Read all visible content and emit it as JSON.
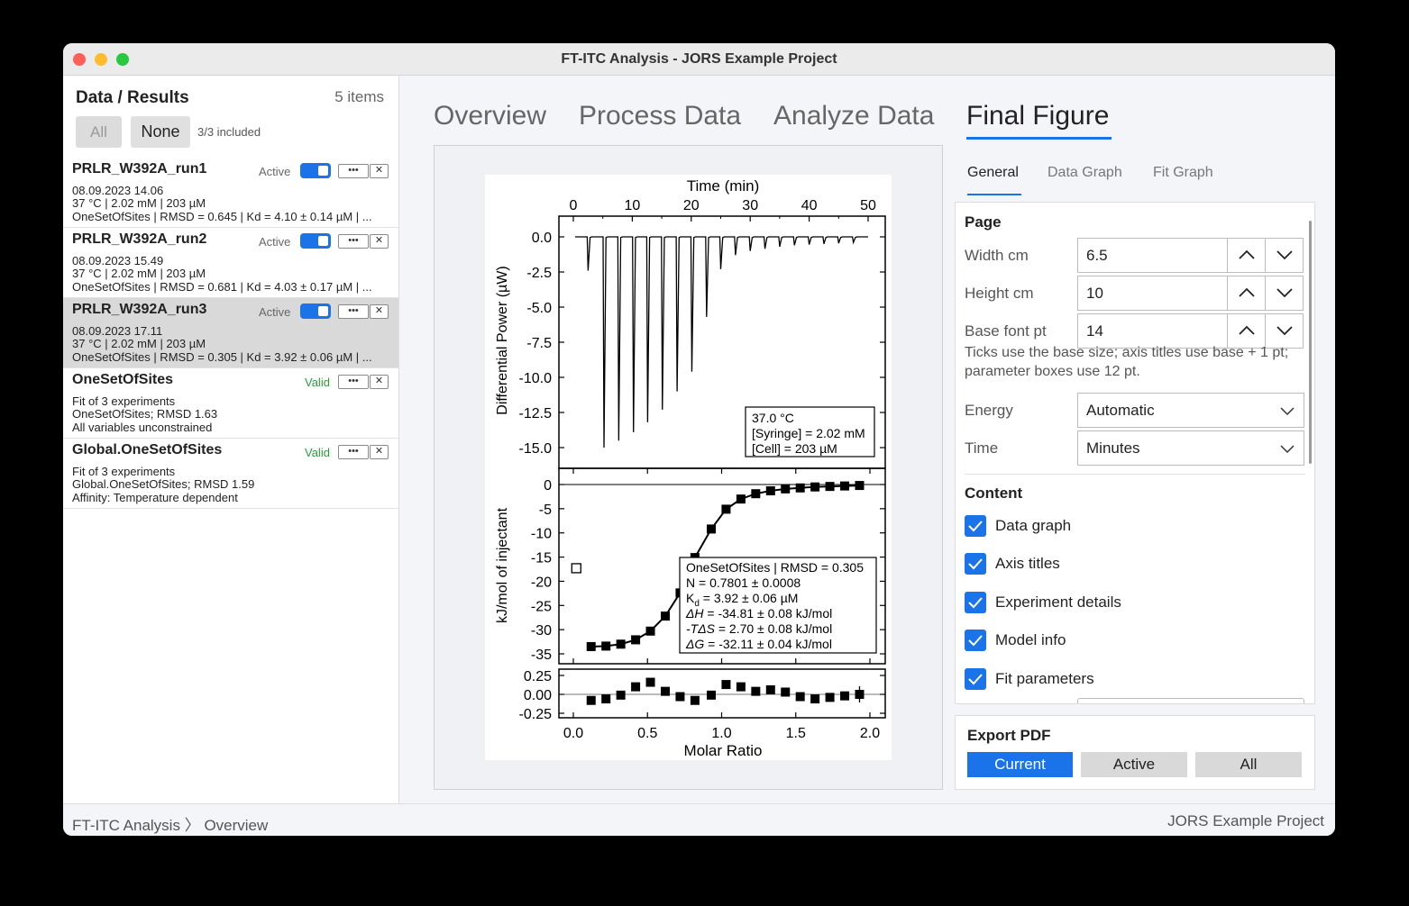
{
  "window": {
    "title": "FT-ITC Analysis - JORS Example Project"
  },
  "sidebar": {
    "title": "Data / Results",
    "count": "5 items",
    "btn_all": "All",
    "btn_none": "None",
    "included": "3/3 included",
    "items": [
      {
        "name": "PRLR_W392A_run1",
        "status": "Active",
        "line1": "08.09.2023 14.06",
        "line2": "37 °C | 2.02 mM | 203 µM",
        "line3": "OneSetOfSites | RMSD = 0.645 | Kd = 4.10 ± 0.14 µM | ..."
      },
      {
        "name": "PRLR_W392A_run2",
        "status": "Active",
        "line1": "08.09.2023 15.49",
        "line2": "37 °C | 2.02 mM | 203 µM",
        "line3": "OneSetOfSites | RMSD = 0.681 | Kd = 4.03 ± 0.17 µM | ..."
      },
      {
        "name": "PRLR_W392A_run3",
        "status": "Active",
        "line1": "08.09.2023 17.11",
        "line2": "37 °C | 2.02 mM | 203 µM",
        "line3": "OneSetOfSites | RMSD = 0.305 | Kd = 3.92 ± 0.06 µM | ..."
      },
      {
        "name": "OneSetOfSites",
        "status": "Valid",
        "line1": "Fit of 3 experiments",
        "line2": "OneSetOfSites; RMSD 1.63",
        "line3": "All variables unconstrained"
      },
      {
        "name": "Global.OneSetOfSites",
        "status": "Valid",
        "line1": "Fit of 3 experiments",
        "line2": "Global.OneSetOfSites; RMSD 1.59",
        "line3": "Affinity: Temperature dependent"
      }
    ]
  },
  "tabs": [
    "Overview",
    "Process Data",
    "Analyze Data",
    "Final Figure"
  ],
  "subtabs": [
    "General",
    "Data Graph",
    "Fit Graph"
  ],
  "figure": {
    "top_xlabel": "Time (min)",
    "top_ylabel": "Differential Power (µW)",
    "bottom_xlabel": "Molar Ratio",
    "mid_ylabel": "kJ/mol of injectant",
    "time_ticks": [
      "0",
      "10",
      "20",
      "30",
      "40",
      "50"
    ],
    "power_ticks": [
      "0.0",
      "-2.5",
      "-5.0",
      "-7.5",
      "-10.0",
      "-12.5",
      "-15.0"
    ],
    "enthalpy_ticks": [
      "0",
      "-5",
      "-10",
      "-15",
      "-20",
      "-25",
      "-30",
      "-35"
    ],
    "residual_ticks": [
      "0.25",
      "0.00",
      "-0.25"
    ],
    "ratio_ticks": [
      "0.0",
      "0.5",
      "1.0",
      "1.5",
      "2.0"
    ],
    "cond_box": [
      "37.0 °C",
      "[Syringe] = 2.02 mM",
      "[Cell] = 203 µM"
    ],
    "fit_box": {
      "line1": "OneSetOfSites | RMSD = 0.305",
      "line2": "N = 0.7801 ± 0.0008",
      "kd_sym": "K",
      "kd_sub": "d",
      "kd_val": " = 3.92 ± 0.06 µM",
      "dh_sym": "ΔH",
      "dh_val": " = -34.81 ± 0.08 kJ/mol",
      "ts_sym": "-TΔS",
      "ts_val": " = 2.70 ± 0.08 kJ/mol",
      "dg_sym": "ΔG",
      "dg_val": " = -32.11 ± 0.04 kJ/mol"
    },
    "injections": [
      {
        "t": 2.5,
        "p": -2.4
      },
      {
        "t": 5.2,
        "p": -15.0
      },
      {
        "t": 7.7,
        "p": -14.5
      },
      {
        "t": 10.2,
        "p": -13.9
      },
      {
        "t": 12.6,
        "p": -13.2
      },
      {
        "t": 15.1,
        "p": -12.3
      },
      {
        "t": 17.6,
        "p": -11.0
      },
      {
        "t": 20.1,
        "p": -9.6
      },
      {
        "t": 22.6,
        "p": -5.7
      },
      {
        "t": 25.0,
        "p": -2.3
      },
      {
        "t": 27.5,
        "p": -1.3
      },
      {
        "t": 30.0,
        "p": -1.0
      },
      {
        "t": 32.5,
        "p": -0.85
      },
      {
        "t": 35.0,
        "p": -0.7
      },
      {
        "t": 37.5,
        "p": -0.6
      },
      {
        "t": 40.0,
        "p": -0.55
      },
      {
        "t": 42.5,
        "p": -0.5
      },
      {
        "t": 45.0,
        "p": -0.45
      },
      {
        "t": 47.5,
        "p": -0.4
      }
    ],
    "isotherm_points": [
      {
        "x": 0.12,
        "y": -33.5,
        "r": -0.08
      },
      {
        "x": 0.22,
        "y": -33.4,
        "r": -0.06
      },
      {
        "x": 0.32,
        "y": -33.0,
        "r": -0.01
      },
      {
        "x": 0.42,
        "y": -32.1,
        "r": 0.1
      },
      {
        "x": 0.52,
        "y": -30.3,
        "r": 0.16
      },
      {
        "x": 0.62,
        "y": -27.2,
        "r": 0.04
      },
      {
        "x": 0.72,
        "y": -22.4,
        "r": -0.03
      },
      {
        "x": 0.82,
        "y": -15.1,
        "r": -0.08
      },
      {
        "x": 0.93,
        "y": -9.2,
        "r": -0.01
      },
      {
        "x": 1.03,
        "y": -5.1,
        "r": 0.13
      },
      {
        "x": 1.13,
        "y": -3.0,
        "r": 0.1
      },
      {
        "x": 1.23,
        "y": -1.9,
        "r": 0.04
      },
      {
        "x": 1.33,
        "y": -1.3,
        "r": 0.06
      },
      {
        "x": 1.43,
        "y": -0.9,
        "r": 0.03
      },
      {
        "x": 1.53,
        "y": -0.7,
        "r": -0.03
      },
      {
        "x": 1.63,
        "y": -0.5,
        "r": -0.06
      },
      {
        "x": 1.73,
        "y": -0.4,
        "r": -0.04
      },
      {
        "x": 1.83,
        "y": -0.3,
        "r": -0.02
      },
      {
        "x": 1.93,
        "y": -0.2,
        "r": 0.0
      }
    ],
    "excluded_point": {
      "x": 0.02,
      "y": -17.3
    }
  },
  "settings": {
    "page_title": "Page",
    "width_label": "Width cm",
    "width_value": "6.5",
    "height_label": "Height cm",
    "height_value": "10",
    "font_label": "Base font pt",
    "font_value": "14",
    "hint": "Ticks use the base size; axis titles use base + 1 pt; parameter boxes use 12 pt.",
    "energy_label": "Energy",
    "energy_value": "Automatic",
    "time_label": "Time",
    "time_value": "Minutes",
    "content_title": "Content",
    "checkboxes": [
      "Data graph",
      "Axis titles",
      "Experiment details",
      "Model info",
      "Fit parameters"
    ]
  },
  "export": {
    "title": "Export PDF",
    "current": "Current",
    "active": "Active",
    "all": "All"
  },
  "status": {
    "crumb_app": "FT-ITC Analysis",
    "crumb_sep": "〉",
    "crumb_page": "Overview",
    "project": "JORS Example Project"
  },
  "chart_data": {
    "type": "line",
    "title": "",
    "panels": [
      {
        "name": "thermogram",
        "xlabel": "Time (min)",
        "ylabel": "Differential Power (µW)",
        "xlim": [
          0,
          50
        ],
        "ylim": [
          -15,
          0
        ]
      },
      {
        "name": "isotherm",
        "xlabel": "Molar Ratio",
        "ylabel": "kJ/mol of injectant",
        "xlim": [
          0,
          2
        ],
        "ylim": [
          -35,
          0
        ]
      },
      {
        "name": "residuals",
        "xlabel": "Molar Ratio",
        "ylabel": "",
        "xlim": [
          0,
          2
        ],
        "ylim": [
          -0.25,
          0.25
        ]
      }
    ]
  }
}
